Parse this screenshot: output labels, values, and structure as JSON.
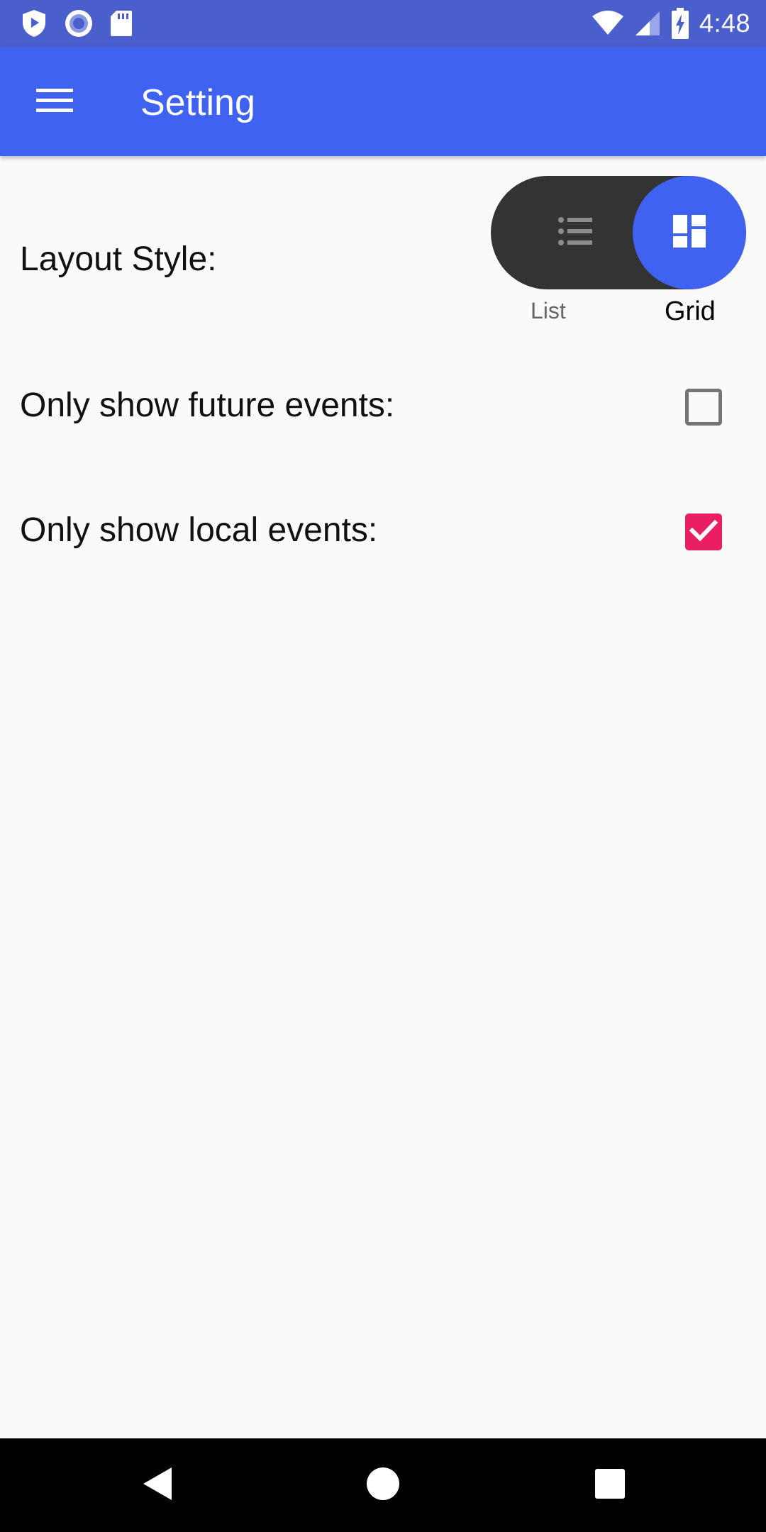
{
  "status_bar": {
    "time": "4:48",
    "left_icons": [
      "shield-play-icon",
      "circle-record-icon",
      "sd-card-icon"
    ],
    "right_icons": [
      "wifi-icon",
      "signal-icon",
      "battery-charging-icon"
    ]
  },
  "app_bar": {
    "title": "Setting",
    "menu_icon": "menu-icon"
  },
  "settings": {
    "layout_style": {
      "label": "Layout Style:",
      "options": [
        "List",
        "Grid"
      ],
      "selected": "Grid"
    },
    "future_events": {
      "label": "Only show future events:",
      "checked": false
    },
    "local_events": {
      "label": "Only show local events:",
      "checked": true
    }
  },
  "colors": {
    "status_bar": "#4b5fcc",
    "app_bar": "#4062f0",
    "toggle_track": "#333333",
    "toggle_knob": "#4062f0",
    "checkbox_checked": "#e91e63",
    "background": "#fafafa"
  },
  "nav_bar": {
    "buttons": [
      "back-icon",
      "home-icon",
      "recents-icon"
    ]
  }
}
